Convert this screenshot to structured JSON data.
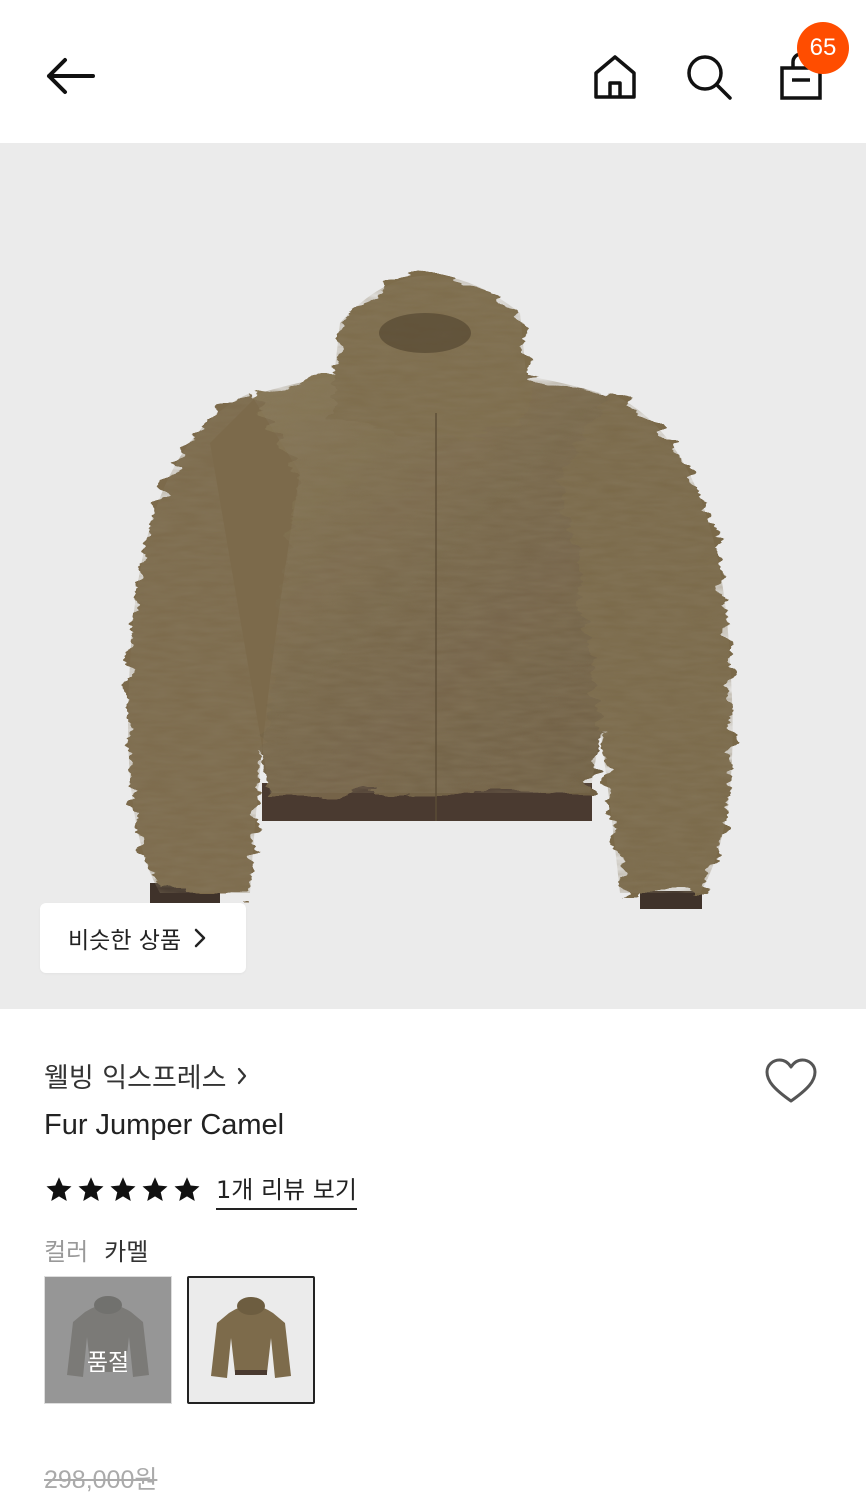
{
  "header": {
    "back_icon": "arrow-left-icon",
    "home_icon": "home-icon",
    "search_icon": "search-icon",
    "cart_icon": "shopping-bag-icon",
    "cart_count": "65",
    "badge_color": "#ff4d00"
  },
  "hero": {
    "image_name": "fur-jumper-image",
    "background": "#ebebeb",
    "similar_button_label": "비슷한 상품"
  },
  "product": {
    "brand": "웰빙 익스프레스",
    "title": "Fur Jumper Camel",
    "rating": 5,
    "rating_max": 5,
    "review_link": "1개 리뷰 보기",
    "color_label": "컬러",
    "color_value": "카멜",
    "swatches": [
      {
        "image_name": "grey-fur-jumper-thumbnail",
        "status": "품절"
      },
      {
        "image_name": "camel-fur-jumper-thumbnail",
        "status": ""
      }
    ],
    "original_price": "298,000원"
  }
}
